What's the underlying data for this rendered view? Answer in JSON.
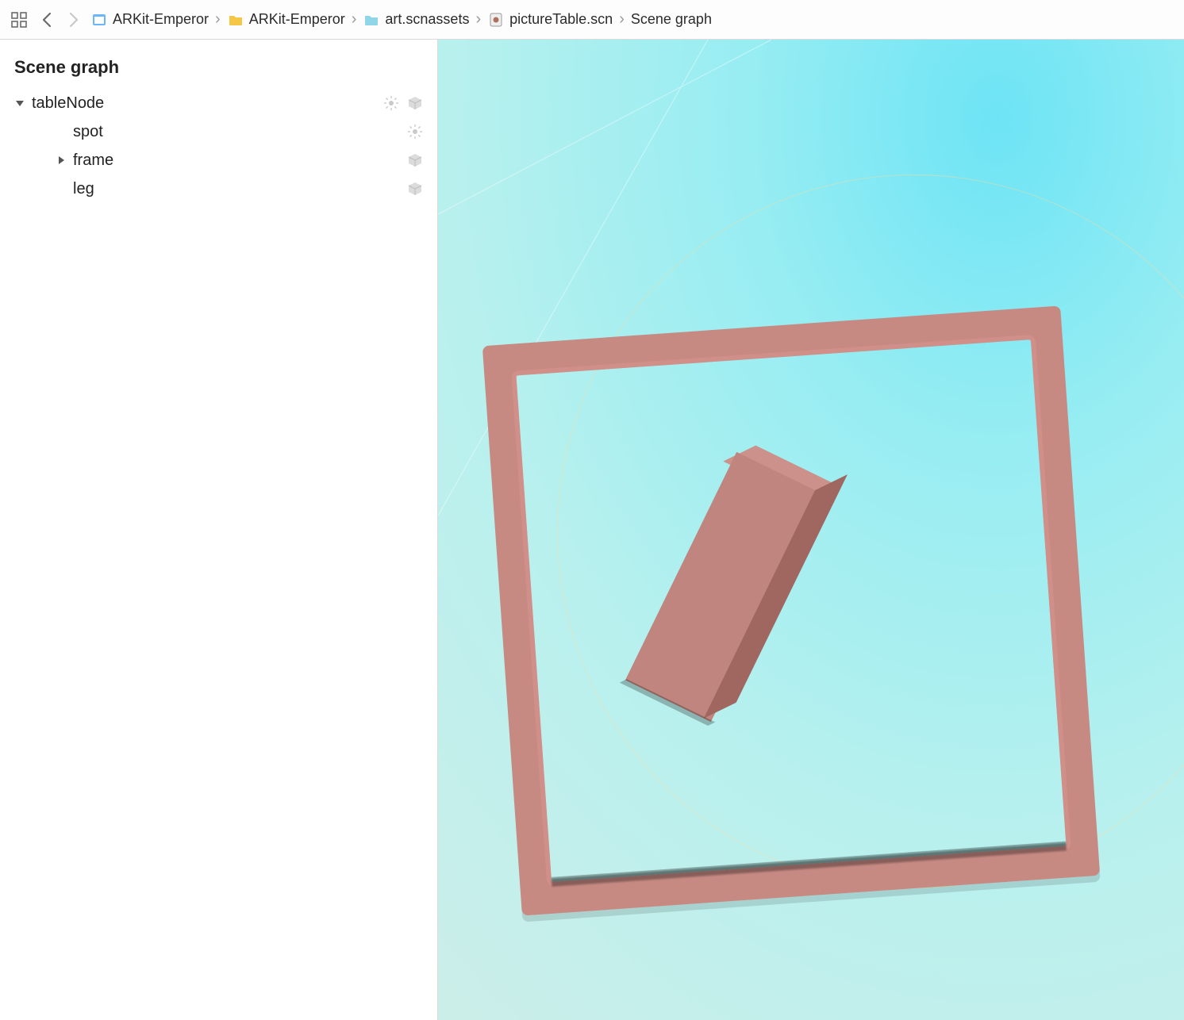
{
  "toolbar": {
    "nav_back_enabled": true,
    "nav_forward_enabled": false
  },
  "breadcrumbs": [
    {
      "label": "ARKit-Emperor",
      "icon": "project-icon"
    },
    {
      "label": "ARKit-Emperor",
      "icon": "folder-icon"
    },
    {
      "label": "art.scnassets",
      "icon": "assets-folder-icon"
    },
    {
      "label": "pictureTable.scn",
      "icon": "scene-file-icon"
    },
    {
      "label": "Scene graph",
      "icon": ""
    }
  ],
  "sidebar": {
    "title": "Scene graph",
    "nodes": [
      {
        "name": "tableNode",
        "depth": 0,
        "expanded": true,
        "hasChildren": true,
        "icons": [
          "light-icon",
          "cube-icon"
        ]
      },
      {
        "name": "spot",
        "depth": 1,
        "expanded": false,
        "hasChildren": false,
        "icons": [
          "light-icon"
        ]
      },
      {
        "name": "frame",
        "depth": 1,
        "expanded": false,
        "hasChildren": true,
        "icons": [
          "cube-icon"
        ]
      },
      {
        "name": "leg",
        "depth": 1,
        "expanded": false,
        "hasChildren": false,
        "icons": [
          "cube-icon"
        ]
      }
    ]
  },
  "scene": {
    "objects": [
      "frame",
      "leg"
    ],
    "frame_color": "#c78a83",
    "leg_color": "#bf857e",
    "background_gradient": [
      "#6de4f5",
      "#cdeee8"
    ]
  }
}
